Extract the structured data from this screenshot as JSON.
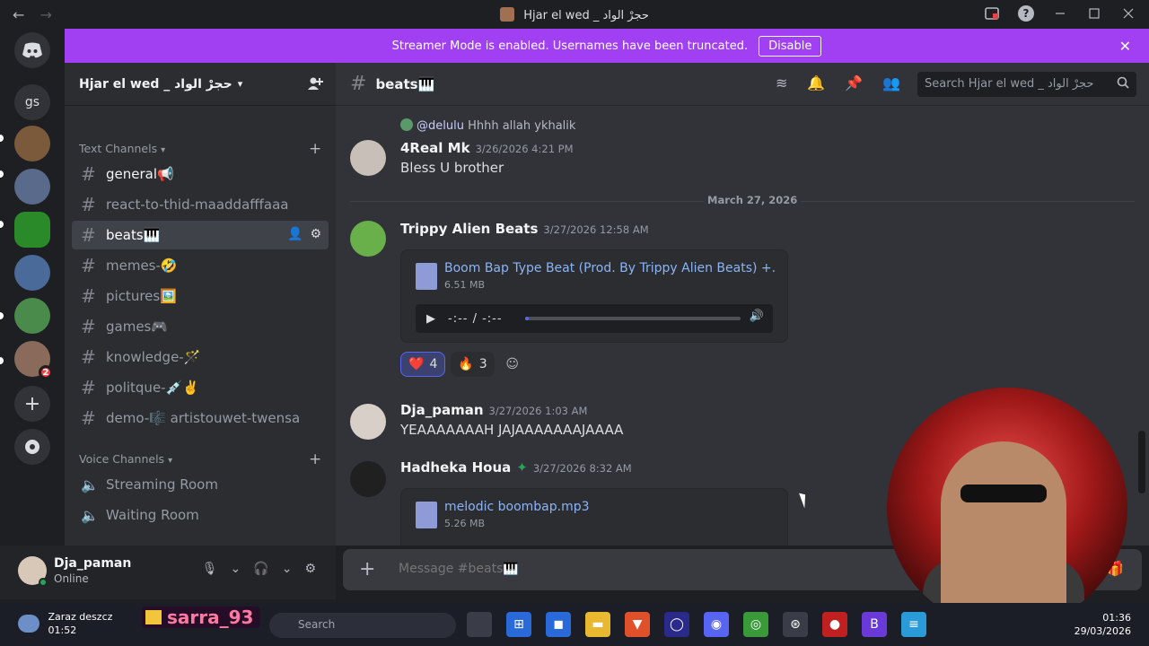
{
  "window": {
    "title": "Hjar el wed _ حجرْ الواد",
    "back_icon": "←",
    "forward_icon": "→",
    "help_icon": "?"
  },
  "banner": {
    "text": "Streamer Mode is enabled. Usernames have been truncated.",
    "button": "Disable",
    "close": "✕",
    "color": "#a13ff2"
  },
  "rail": {
    "servers": [
      {
        "label": "gs"
      }
    ],
    "dm_badge": "2",
    "add": "+"
  },
  "sidebar": {
    "server_name": "Hjar el wed _ حجرْ الواد",
    "text_category": "Text Channels",
    "voice_category": "Voice Channels",
    "channels": [
      {
        "name": "general📢"
      },
      {
        "name": "react-to-thid-maaddafffaaa"
      },
      {
        "name": "beats🎹"
      },
      {
        "name": "memes-🤣"
      },
      {
        "name": "pictures🖼️"
      },
      {
        "name": "games🎮"
      },
      {
        "name": "knowledge-🪄"
      },
      {
        "name": "politque-💉✌️"
      },
      {
        "name": "demo-🎼 artistouwet-twensa"
      }
    ],
    "voice_channels": [
      {
        "name": "Streaming Room"
      },
      {
        "name": "Waiting Room"
      }
    ]
  },
  "user": {
    "name": "Dja_paman",
    "status": "Online"
  },
  "chat": {
    "channel": "beats🎹",
    "search_placeholder": "Search Hjar el wed _ حجرْ الواد",
    "reply": {
      "mention": "@delulu",
      "text": "Hhhh allah ykhalik"
    },
    "messages": [
      {
        "author": "4Real Mk",
        "time": "3/26/2026 4:21 PM",
        "text": "Bless U  brother"
      },
      {
        "author": "Trippy Alien Beats",
        "time": "3/27/2026 12:58 AM",
        "text": ""
      },
      {
        "author": "Dja_paman",
        "time": "3/27/2026 1:03 AM",
        "text": "YEAAAAAAAH JAJAAAAAAAJAAAA"
      },
      {
        "author": "Hadheka Houa",
        "time": "3/27/2026 8:32 AM",
        "text": ""
      }
    ],
    "date_divider": "March 27, 2026",
    "attachments": [
      {
        "name": "Boom Bap Type Beat (Prod. By Trippy Alien Beats) +.mp",
        "size": "6.51 MB",
        "time": "-:-- / -:--",
        "progress": 0.01
      },
      {
        "name": "melodic boombap.mp3",
        "size": "5.26 MB"
      }
    ],
    "reactions": [
      {
        "emoji": "❤️",
        "count": "4"
      },
      {
        "emoji": "🔥",
        "count": "3"
      }
    ],
    "composer_placeholder": "Message #beats🎹"
  },
  "overlay": {
    "name": "sarra_93"
  },
  "taskbar": {
    "weather_title": "Zaraz deszcz",
    "weather_time": "01:52",
    "search": "Search",
    "time": "01:36",
    "date": "29/03/2026"
  }
}
